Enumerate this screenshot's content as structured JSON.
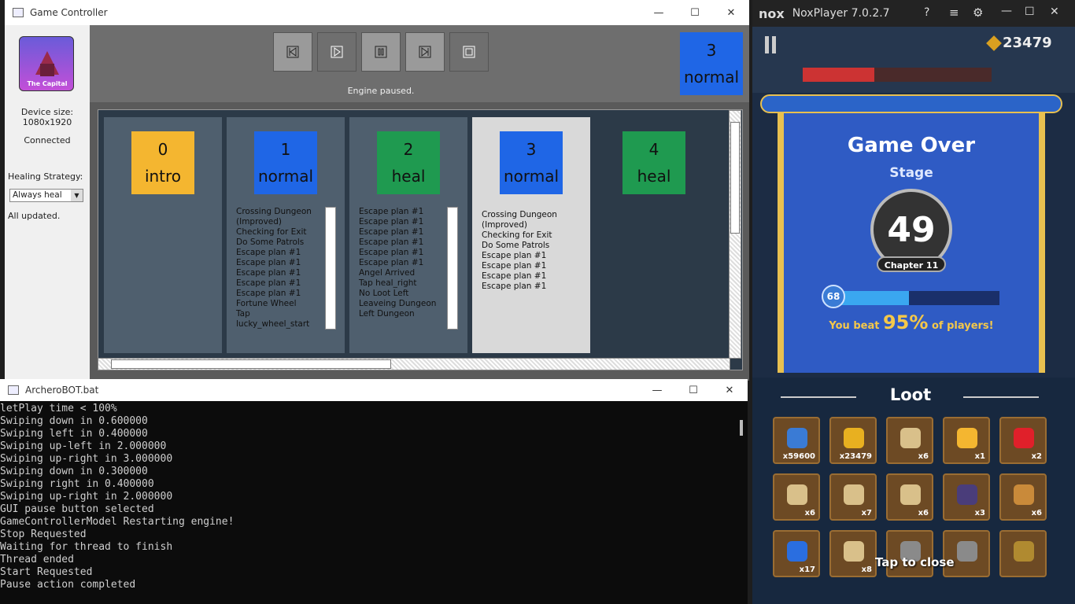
{
  "game_controller": {
    "title": "Game Controller",
    "minimize": "—",
    "maximize": "☐",
    "close": "✕",
    "logo_text": "The Capital",
    "device_size_label": "Device size:",
    "device_size_value": "1080x1920",
    "connection_status": "Connected",
    "healing_label": "Healing Strategy:",
    "healing_value": "Always heal",
    "update_status": "All updated.",
    "engine_status": "Engine paused.",
    "current_state": {
      "index": "3",
      "name": "normal"
    },
    "toolbar": [
      "skip-back",
      "play",
      "pause",
      "skip-forward",
      "stop"
    ],
    "cards": [
      {
        "index": "0",
        "name": "intro",
        "color": "#f4b630",
        "logs": []
      },
      {
        "index": "1",
        "name": "normal",
        "color": "#1f66e6",
        "logs": [
          "Crossing Dungeon",
          "(Improved)",
          "Checking for Exit",
          "Do Some Patrols",
          "Escape plan #1",
          "Escape plan #1",
          "Escape plan #1",
          "Escape plan #1",
          "Escape plan #1",
          "Fortune Wheel",
          "Tap",
          "lucky_wheel_start"
        ]
      },
      {
        "index": "2",
        "name": "heal",
        "color": "#1f9a50",
        "logs": [
          "Escape plan #1",
          "Escape plan #1",
          "Escape plan #1",
          "Escape plan #1",
          "Escape plan #1",
          "Escape plan #1",
          "Angel Arrived",
          "Tap heal_right",
          "No Loot Left",
          "Leaveing Dungeon",
          "Left Dungeon"
        ]
      },
      {
        "index": "3",
        "name": "normal",
        "color": "#1f66e6",
        "logs": [
          "Crossing Dungeon",
          "(Improved)",
          "Checking for Exit",
          "Do Some Patrols",
          "Escape plan #1",
          "Escape plan #1",
          "Escape plan #1",
          "Escape plan #1"
        ]
      },
      {
        "index": "4",
        "name": "heal",
        "color": "#1f9a50",
        "logs": []
      }
    ]
  },
  "console": {
    "title": "ArcheroBOT.bat",
    "minimize": "—",
    "maximize": "☐",
    "close": "✕",
    "lines": [
      "letPlay time < 100%",
      "Swiping down in 0.600000",
      "Swiping left in 0.400000",
      "Swiping up-left in 2.000000",
      "Swiping up-right in 3.000000",
      "Swiping down in 0.300000",
      "Swiping right in 0.400000",
      "Swiping up-right in 2.000000",
      "GUI pause button selected",
      "GameControllerModel Restarting engine!",
      "Stop Requested",
      "Waiting for thread to finish",
      "Thread ended",
      "Start Requested",
      "Pause action completed"
    ]
  },
  "nox": {
    "logo": "nox",
    "title": "NoxPlayer 7.0.2.7",
    "coins": "23479",
    "game_over": "Game Over",
    "stage_label": "Stage",
    "stage_number": "49",
    "chapter": "Chapter 11",
    "level": "68",
    "level_progress": 0.45,
    "beat_prefix": "You beat",
    "beat_percent": "95%",
    "beat_suffix": "of players!",
    "loot_title": "Loot",
    "tap_to_close": "Tap to close",
    "loot_items": [
      {
        "name": "xp-icon",
        "count": "x59600",
        "color": "#3a7bd5"
      },
      {
        "name": "gold-icon",
        "count": "x23479",
        "color": "#e8b020"
      },
      {
        "name": "scroll-icon",
        "count": "x6",
        "color": "#d9c08a"
      },
      {
        "name": "gem-icon",
        "count": "x1",
        "color": "#f4b630"
      },
      {
        "name": "ruby-icon",
        "count": "x2",
        "color": "#e0202a"
      },
      {
        "name": "ring-scroll-icon",
        "count": "x6",
        "color": "#d9c08a"
      },
      {
        "name": "bow-scroll-icon",
        "count": "x7",
        "color": "#d9c08a"
      },
      {
        "name": "paw-scroll-icon",
        "count": "x6",
        "color": "#d9c08a"
      },
      {
        "name": "dark-stone-icon",
        "count": "x3",
        "color": "#4a3d7a"
      },
      {
        "name": "cookie-icon",
        "count": "x6",
        "color": "#c98a3a"
      },
      {
        "name": "blue-crystal-icon",
        "count": "x17",
        "color": "#2a6ee0"
      },
      {
        "name": "armor-scroll-icon",
        "count": "x8",
        "color": "#d9c08a"
      },
      {
        "name": "wolf-pendant-icon",
        "count": "",
        "color": "#8a8a8a"
      },
      {
        "name": "silver-ring-icon",
        "count": "",
        "color": "#8a8a8a"
      },
      {
        "name": "gold-ring-icon",
        "count": "",
        "color": "#b08a30"
      }
    ]
  }
}
